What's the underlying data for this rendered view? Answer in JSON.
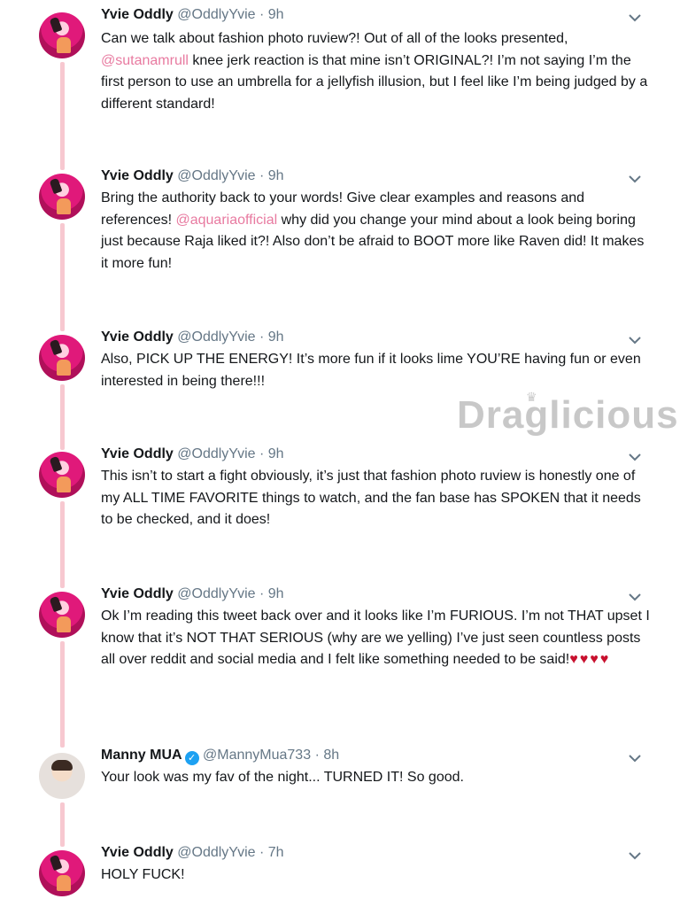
{
  "watermark": "Draglicious",
  "tweets": [
    {
      "name": "Yvie Oddly",
      "handle": "@OddlyYvie",
      "time": "9h",
      "avatar": "yvie-avatar",
      "text_before": "Can we talk about fashion photo ruview?! Out of all of the looks presented, ",
      "mention": "@sutanamrull",
      "text_after": " knee jerk reaction is that mine isn’t ORIGINAL?! I’m not saying I’m the first person to use an umbrella for a jellyfish illusion, but I feel like I’m being judged by a different standard!"
    },
    {
      "name": "Yvie Oddly",
      "handle": "@OddlyYvie",
      "time": "9h",
      "avatar": "yvie-avatar",
      "text_before": "Bring the authority back to your words! Give clear examples and reasons and references! ",
      "mention": "@aquariaofficial",
      "text_after": " why did you change your mind about a look being boring just because Raja liked it?! Also don’t be afraid to BOOT more like Raven did! It makes it more fun!"
    },
    {
      "name": "Yvie Oddly",
      "handle": "@OddlyYvie",
      "time": "9h",
      "avatar": "yvie-avatar",
      "text": "Also, PICK UP THE ENERGY! It’s more fun if it looks lime YOU’RE having fun or even interested in being there!!!"
    },
    {
      "name": "Yvie Oddly",
      "handle": "@OddlyYvie",
      "time": "9h",
      "avatar": "yvie-avatar",
      "text": "This isn’t to start a fight obviously, it’s just that fashion photo ruview is honestly one of my ALL TIME FAVORITE things to watch, and the fan base has SPOKEN that it needs to be checked, and it does!"
    },
    {
      "name": "Yvie Oddly",
      "handle": "@OddlyYvie",
      "time": "9h",
      "avatar": "yvie-avatar",
      "text": "Ok I’m reading this tweet back over and it looks like I’m FURIOUS. I’m not THAT upset I know that it’s NOT THAT SERIOUS (why are we yelling) I’ve just seen countless posts all over reddit and social media and I felt like something needed to be said!",
      "hearts": "♥♥♥♥"
    },
    {
      "name": "Manny MUA",
      "handle": "@MannyMua733",
      "time": "8h",
      "avatar": "manny-avatar",
      "verified": true,
      "text": "Your look was my fav of the night... TURNED IT! So good."
    },
    {
      "name": "Yvie Oddly",
      "handle": "@OddlyYvie",
      "time": "7h",
      "avatar": "yvie-avatar",
      "text": "HOLY FUCK!"
    }
  ],
  "separator": "·",
  "colors": {
    "mention": "#e87aa0",
    "thread_line": "#f7c8d0",
    "verified": "#1da1f2",
    "heart": "#c8102e"
  },
  "icons": {
    "menu": "chevron-down-icon",
    "verified": "verified-badge-icon"
  }
}
